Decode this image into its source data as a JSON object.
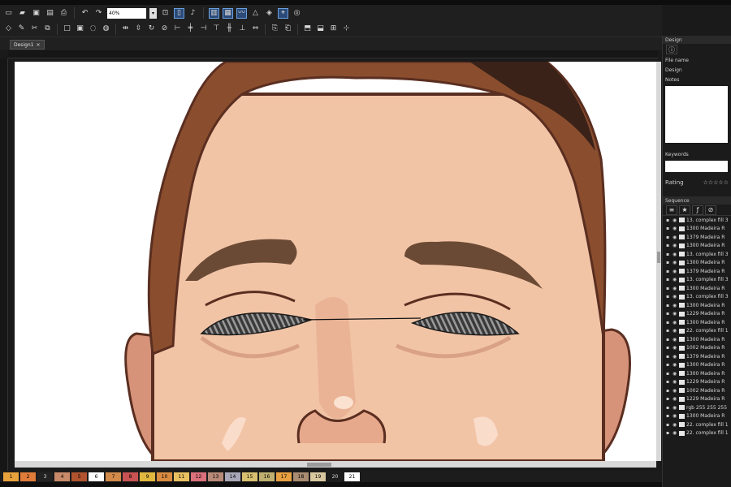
{
  "toolbar": {
    "zoom_value": "40%",
    "row1_icons": [
      "new-icon",
      "open-icon",
      "save-icon",
      "save-all-icon",
      "print-icon",
      "undo-icon",
      "redo-icon"
    ],
    "row1_tools": [
      "fit-page-icon",
      "microphone-icon",
      "rect-select-icon",
      "column-icon",
      "wave-icon",
      "triangle-icon",
      "shapes-icon",
      "snap-icon",
      "target-icon"
    ],
    "row2_icons": [
      "node-icon",
      "pen-icon",
      "cut-icon",
      "group-icon",
      "rect-icon",
      "combine-icon",
      "dashed-circle-icon",
      "lasso-icon",
      "flip-h-icon",
      "flip-v-icon",
      "rotate-icon",
      "blend-icon",
      "align-left-icon",
      "align-center-icon",
      "align-right-icon",
      "align-top-icon",
      "align-middle-icon",
      "align-bottom-icon",
      "distribute-icon",
      "copy-icon",
      "paste-icon",
      "layer-up-icon",
      "layer-down-icon",
      "grid-icon",
      "center-icon"
    ]
  },
  "document": {
    "tab_label": "Design1",
    "close_glyph": "×"
  },
  "palette": {
    "swatches": [
      {
        "label": "1",
        "color": "#e8a23c"
      },
      {
        "label": "2",
        "color": "#e07b39"
      },
      {
        "label": "3",
        "color": "#222222"
      },
      {
        "label": "4",
        "color": "#c98a6a"
      },
      {
        "label": "5",
        "color": "#b0532e"
      },
      {
        "label": "6",
        "color": "#ffffff"
      },
      {
        "label": "7",
        "color": "#d28a4a"
      },
      {
        "label": "8",
        "color": "#c95252"
      },
      {
        "label": "9",
        "color": "#e0b840"
      },
      {
        "label": "10",
        "color": "#d98b40"
      },
      {
        "label": "11",
        "color": "#e8c060"
      },
      {
        "label": "12",
        "color": "#d9707a"
      },
      {
        "label": "13",
        "color": "#b88a78"
      },
      {
        "label": "14",
        "color": "#a8a8b8"
      },
      {
        "label": "15",
        "color": "#d8c070"
      },
      {
        "label": "16",
        "color": "#c0b070"
      },
      {
        "label": "17",
        "color": "#e8a040"
      },
      {
        "label": "18",
        "color": "#a88b70"
      },
      {
        "label": "19",
        "color": "#d8c8a0"
      },
      {
        "label": "20",
        "color": "#1c1c1c"
      },
      {
        "label": "21",
        "color": "#ffffff"
      }
    ]
  },
  "properties": {
    "header": "Design",
    "filename_label": "File name",
    "design_label": "Design",
    "notes_label": "Notes",
    "keywords_label": "Keywords",
    "rating_label": "Rating",
    "rating_stars": "☆☆☆☆☆"
  },
  "layers": {
    "header": "Sequence",
    "rows": [
      {
        "num": "",
        "text": "13. complex fill 3"
      },
      {
        "num": "",
        "text": "1300 Madeira R"
      },
      {
        "num": "",
        "text": "1379 Madeira R"
      },
      {
        "num": "",
        "text": "1300 Madeira R"
      },
      {
        "num": "",
        "text": "13. complex fill 3"
      },
      {
        "num": "",
        "text": "1300 Madeira R"
      },
      {
        "num": "",
        "text": "1379 Madeira R"
      },
      {
        "num": "",
        "text": "13. complex fill 3"
      },
      {
        "num": "",
        "text": "1300 Madeira R"
      },
      {
        "num": "",
        "text": "13. complex fill 3"
      },
      {
        "num": "",
        "text": "1300 Madeira R"
      },
      {
        "num": "",
        "text": "1229 Madeira R"
      },
      {
        "num": "",
        "text": "1300 Madeira R"
      },
      {
        "num": "",
        "text": "22. complex fill 1"
      },
      {
        "num": "",
        "text": "1300 Madeira R"
      },
      {
        "num": "",
        "text": "1002 Madeira R"
      },
      {
        "num": "",
        "text": "1379 Madeira R"
      },
      {
        "num": "",
        "text": "1300 Madeira R"
      },
      {
        "num": "",
        "text": "1300 Madeira R"
      },
      {
        "num": "",
        "text": "1229 Madeira R"
      },
      {
        "num": "",
        "text": "1002 Madeira R"
      },
      {
        "num": "",
        "text": "1229 Madeira R"
      },
      {
        "num": "",
        "text": "rgb 255 255 255"
      },
      {
        "num": "",
        "text": "1300 Madeira R"
      },
      {
        "num": "",
        "text": "22. complex fill 1"
      },
      {
        "num": "",
        "text": "22. complex fill 1"
      }
    ]
  }
}
